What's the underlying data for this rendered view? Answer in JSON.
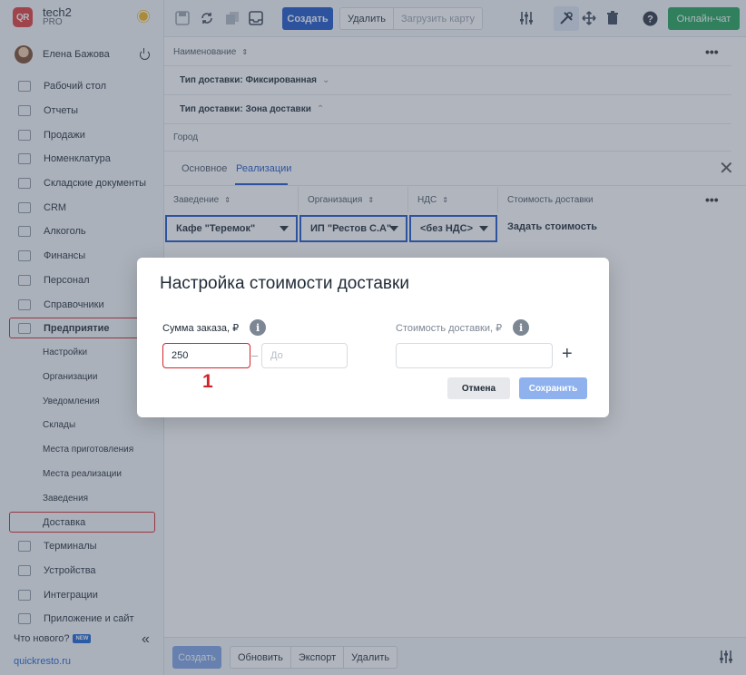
{
  "sidebar": {
    "brand": {
      "logo": "QR",
      "name": "tech2",
      "plan": "PRO"
    },
    "user": {
      "name": "Елена Бажова"
    },
    "items": [
      {
        "label": "Рабочий стол"
      },
      {
        "label": "Отчеты"
      },
      {
        "label": "Продажи"
      },
      {
        "label": "Номенклатура"
      },
      {
        "label": "Складские документы"
      },
      {
        "label": "CRM"
      },
      {
        "label": "Алкоголь"
      },
      {
        "label": "Финансы"
      },
      {
        "label": "Персонал"
      },
      {
        "label": "Справочники"
      },
      {
        "label": "Предприятие"
      }
    ],
    "subitems": [
      {
        "label": "Настройки"
      },
      {
        "label": "Организации"
      },
      {
        "label": "Уведомления"
      },
      {
        "label": "Склады"
      },
      {
        "label": "Места приготовления"
      },
      {
        "label": "Места реализации"
      },
      {
        "label": "Заведения"
      },
      {
        "label": "Доставка"
      }
    ],
    "items_after": [
      {
        "label": "Терминалы"
      },
      {
        "label": "Устройства"
      },
      {
        "label": "Интеграции"
      },
      {
        "label": "Приложение и сайт"
      }
    ],
    "whats_new": "Что нового?",
    "new_badge": "NEW",
    "site_link": "quickresto.ru"
  },
  "toolbar": {
    "create_label": "Создать",
    "delete_label": "Удалить",
    "load_map_label": "Загрузить карту",
    "chat_label": "Онлайн-чат"
  },
  "content": {
    "name_header": "Наименование",
    "group_fixed": "Тип доставки: Фиксированная",
    "group_zone": "Тип доставки: Зона доставки",
    "city": "Город",
    "tabs": [
      {
        "label": "Основное"
      },
      {
        "label": "Реализации"
      }
    ],
    "columns": [
      {
        "label": "Заведение"
      },
      {
        "label": "Организация"
      },
      {
        "label": "НДС"
      },
      {
        "label": "Стоимость доставки"
      }
    ],
    "row": {
      "venue": "Кафе \"Теремок\"",
      "org": "ИП \"Рестов С.А\"",
      "vat": "<без НДС>",
      "cost": "Задать стоимость"
    }
  },
  "bottombar": {
    "save_label": "Создать",
    "refresh_label": "Обновить",
    "export_label": "Экспорт",
    "delete_label": "Удалить"
  },
  "modal": {
    "title": "Настройка стоимости доставки",
    "order_sum_label": "Сумма заказа, ₽",
    "from_value": "250",
    "to_placeholder": "До",
    "delivery_cost_label": "Стоимость доставки, ₽",
    "cancel_label": "Отмена",
    "save_label": "Сохранить",
    "annotation": "1"
  },
  "colors": {
    "accent": "#1e55c8",
    "highlight": "#d2232a",
    "chat": "#22a35a"
  }
}
